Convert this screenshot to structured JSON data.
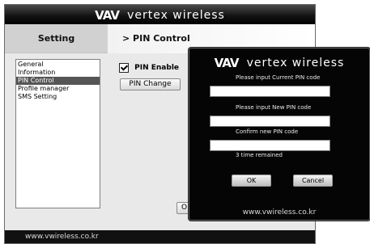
{
  "brand": {
    "logo": "VAV",
    "name": "vertex wireless"
  },
  "tabs": {
    "setting": "Setting"
  },
  "breadcrumb": "> PIN Control",
  "menu": {
    "items": [
      {
        "label": "General",
        "selected": false
      },
      {
        "label": "Information",
        "selected": false
      },
      {
        "label": "PIN Control",
        "selected": true
      },
      {
        "label": "Profile manager",
        "selected": false
      },
      {
        "label": "SMS Setting",
        "selected": false
      }
    ]
  },
  "pin_control": {
    "pin_enable_label": "PIN Enable",
    "pin_enable_checked": true,
    "pin_change_label": "PIN Change",
    "ok_label": "OK"
  },
  "footer": {
    "url": "www.vwireless.co.kr"
  },
  "dialog": {
    "current_pin_label": "Please input Current PIN code",
    "current_pin_value": "",
    "new_pin_label": "Please input New PIN code",
    "new_pin_value": "",
    "confirm_pin_label": "Confirm new PIN code",
    "confirm_pin_value": "",
    "remaining": "3 time remained",
    "ok_label": "OK",
    "cancel_label": "Cancel",
    "footer_url": "www.vwireless.co.kr"
  },
  "colors": {
    "titlebar": "#151515",
    "dialog_bg": "#050505",
    "selected_item": "#555555",
    "window_bg": "#e9e9e9"
  }
}
